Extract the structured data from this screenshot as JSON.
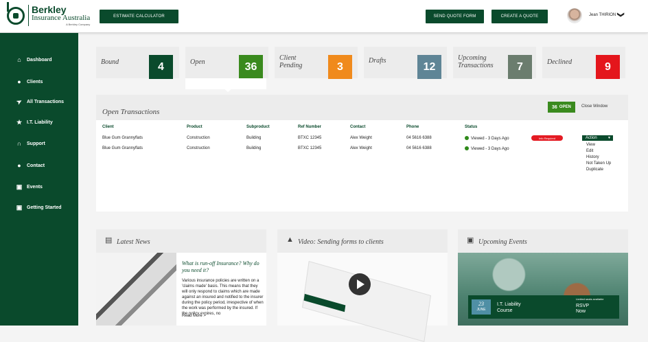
{
  "brand": {
    "name": "Berkley",
    "sub": "Insurance Australia",
    "tagline": "A Berkley Company"
  },
  "header": {
    "estimate_btn": "ESTIMATE CALCULATOR",
    "send_quote_btn": "SEND QUOTE FORM",
    "create_quote_btn": "CREATE A QUOTE",
    "user_name": "Jean THIRION",
    "chevron": "❯"
  },
  "sidebar": {
    "items": [
      {
        "label": "Dashboard",
        "icon": "home-icon",
        "glyph": "⌂"
      },
      {
        "label": "Clients",
        "icon": "user-icon",
        "glyph": "●"
      },
      {
        "label": "All Transactions",
        "icon": "send-icon",
        "glyph": "➤"
      },
      {
        "label": "I.T. Liability",
        "icon": "star-icon",
        "glyph": "★"
      },
      {
        "label": "Support",
        "icon": "headset-icon",
        "glyph": "∩"
      },
      {
        "label": "Contact",
        "icon": "chat-icon",
        "glyph": "●"
      },
      {
        "label": "Events",
        "icon": "calendar-icon",
        "glyph": "▣"
      },
      {
        "label": "Getting Started",
        "icon": "calendar-check-icon",
        "glyph": "▣"
      }
    ]
  },
  "cards": [
    {
      "label": "Bound",
      "value": "4",
      "color": "#0a4a2c"
    },
    {
      "label": "Open",
      "value": "36",
      "color": "#3a8a1e"
    },
    {
      "label": "Client Pending",
      "value": "3",
      "color": "#f08a1c"
    },
    {
      "label": "Drafts",
      "value": "12",
      "color": "#5f8596"
    },
    {
      "label": "Upcoming Transactions",
      "value": "7",
      "color": "#6b7d6e"
    },
    {
      "label": "Declined",
      "value": "9",
      "color": "#e4161c"
    }
  ],
  "open_panel": {
    "title": "Open Transactions",
    "badge_count": "36",
    "badge_label": "OPEN",
    "close_label": "Close Window",
    "columns": [
      "Client",
      "Product",
      "Subproduct",
      "Ref Number",
      "Contact",
      "Phone",
      "Status"
    ],
    "rows": [
      {
        "client": "Blue Gum Grannyflats",
        "product": "Construction",
        "subproduct": "Building",
        "ref": "BTXC 12345",
        "contact": "Alex Weight",
        "phone": "04 5616 6388",
        "status": "Viewed - 3 Days Ago",
        "flag": "Info Required"
      },
      {
        "client": "Blue Gum Grannyflats",
        "product": "Construction",
        "subproduct": "Building",
        "ref": "BTXC 12345",
        "contact": "Alex Weight",
        "phone": "04 5616 6388",
        "status": "Viewed - 3 Days Ago"
      }
    ],
    "action_label": "Action",
    "action_menu": [
      "View",
      "Edit",
      "History",
      "Not Taken Up",
      "Duplicate"
    ]
  },
  "news": {
    "title": "Latest News",
    "headline": "What is run-off Insurance? Why do you need it?",
    "body": "Various insurance policies are written on a 'claims made' basis. This means that they will only respond to claims which are made against an insured and notified to the insurer during the policy period, irrespective of when the work was performed by the insured. If the policy expires, no",
    "read_more": "Read More >"
  },
  "video": {
    "title": "Video: Sending forms to clients"
  },
  "events": {
    "title": "Upcoming Events",
    "day": "23",
    "month": "JUNE",
    "name_line1": "I.T. Liability",
    "name_line2": "Course",
    "limited": "Limited seats available",
    "rsvp_line1": "RSVP",
    "rsvp_line2": "Now"
  }
}
